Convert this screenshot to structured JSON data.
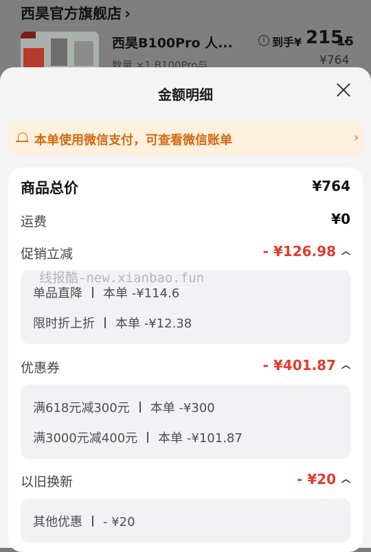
{
  "background": {
    "store_name": "西昊官方旗舰店",
    "product_name": "西昊B100Pro 人...",
    "product_spec": "数量 ×1  B100Pro与...",
    "price_label": "到手¥",
    "price_int": "215.",
    "price_dec": "15",
    "original_price": "¥764"
  },
  "sheet": {
    "title": "金额明细",
    "notice": "本单使用微信支付，可查看微信账单"
  },
  "breakdown": {
    "total_label": "商品总价",
    "total_value": "¥764",
    "shipping_label": "运费",
    "shipping_value": "¥0",
    "promo_label": "促销立减",
    "promo_value": "- ¥126.98",
    "promo_items": [
      {
        "name": "单品直降",
        "detail": "本单 -¥114.6"
      },
      {
        "name": "限时折上折",
        "detail": "本单 -¥12.38"
      }
    ],
    "coupon_label": "优惠券",
    "coupon_value": "- ¥401.87",
    "coupon_items": [
      {
        "name": "满618元减300元",
        "detail": "本单 -¥300"
      },
      {
        "name": "满3000元减400元",
        "detail": "本单 -¥101.87"
      }
    ],
    "tradein_label": "以旧换新",
    "tradein_value": "- ¥20",
    "tradein_items": [
      {
        "name": "其他优惠",
        "detail": "- ¥20"
      }
    ]
  },
  "watermark": "线报酷-new.xianbao.fun",
  "colors": {
    "discount_red": "#e43b2b",
    "notice_orange": "#d16a11",
    "notice_bg": "#fdf0dc"
  }
}
